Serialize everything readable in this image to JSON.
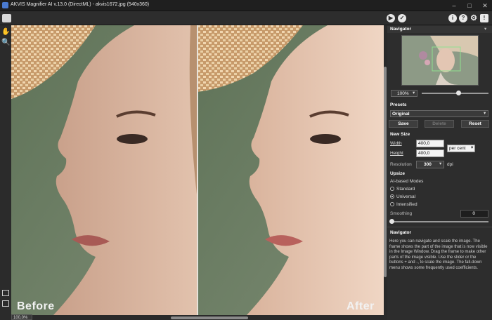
{
  "window": {
    "title": "AKVIS Magnifier AI v.13.0 (DirectML) - akvis1672.jpg (540x360)",
    "controls": [
      "–",
      "□",
      "✕"
    ]
  },
  "toolbar": {
    "run_icon": "▶",
    "apply_icon": "✓",
    "right_icons": [
      "i",
      "?",
      "⚙",
      "!"
    ]
  },
  "canvas": {
    "before_label": "Before",
    "after_label": "After",
    "zoom_status": "100,0%"
  },
  "navigator": {
    "header": "Navigator",
    "zoom_value": "100%",
    "zoom_slider_fraction": 0.55
  },
  "presets": {
    "header": "Presets",
    "selected": "Original",
    "save_label": "Save",
    "delete_label": "Delete",
    "reset_label": "Reset"
  },
  "new_size": {
    "header": "New Size",
    "width_label": "Width",
    "width_value": "400,0",
    "height_label": "Height",
    "height_value": "400,0",
    "unit": "per cent",
    "resolution_label": "Resolution",
    "resolution_value": "300",
    "resolution_unit": "dpi"
  },
  "upsize": {
    "header": "Upsize",
    "modes_label": "AI-based Modes",
    "modes": [
      "Standard",
      "Universal",
      "Intensified"
    ],
    "selected_mode": "Universal",
    "smoothing_label": "Smoothing",
    "smoothing_value": "0"
  },
  "help": {
    "header": "Navigator",
    "body": "Here you can navigate and scale the image. The frame shows the part of the image that is now visible in the Image Window. Drag the frame to make other parts of the image visible. Use the slider or the buttons + and -, to scale the image. The fall-down menu shows some frequently used coefficients."
  },
  "colors": {
    "panel_bg": "#2d2d2d",
    "section_bg": "#353535",
    "accent": "#4a7ad0"
  }
}
